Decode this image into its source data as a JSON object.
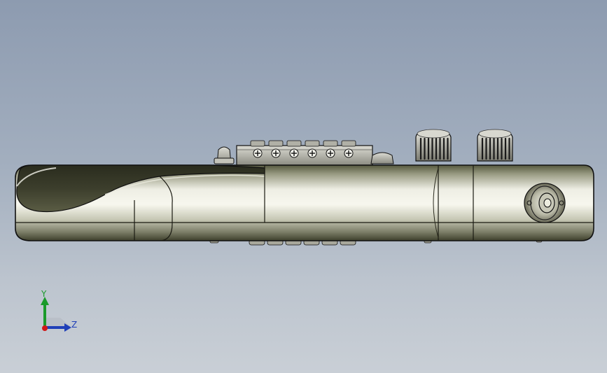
{
  "viewport": {
    "colors": {
      "bg_top": "#8d9bb0",
      "bg_bottom": "#c9cfd6"
    }
  },
  "model": {
    "part": "guitar-body-side-view",
    "bridge_saddle_count": 6,
    "knob_count": 2,
    "output_jack": true,
    "colors": {
      "body_highlight": "#f4f4ea",
      "body_shadow": "#3e402c",
      "outline": "#101010"
    }
  },
  "triad": {
    "y_label": "Y",
    "z_label": "Z",
    "colors": {
      "y_axis": "#1a9a2a",
      "z_axis": "#1f3fb8",
      "origin": "#d01818"
    }
  }
}
